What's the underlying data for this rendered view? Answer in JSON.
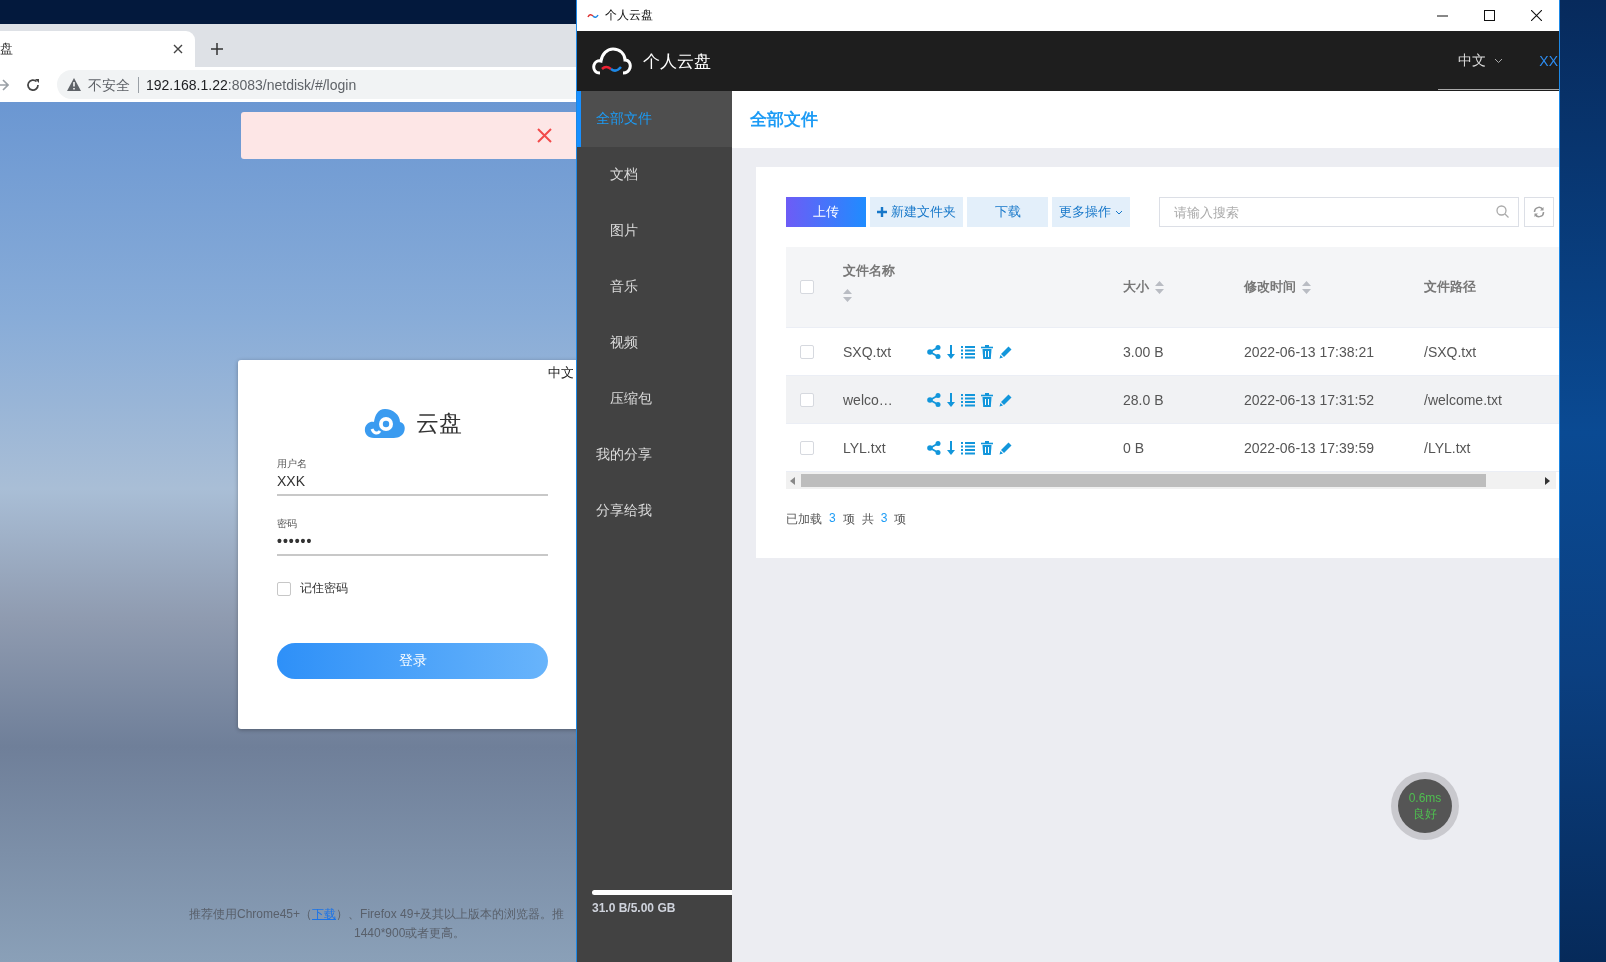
{
  "browser": {
    "tab": {
      "title": "盘",
      "selected": true
    },
    "address": {
      "security": "不安全",
      "host": "192.168.1.22",
      "path": ":8083/netdisk/#/login"
    },
    "alert": {
      "kind": "error"
    },
    "login": {
      "language": "中文",
      "brand": "云盘",
      "fields": [
        {
          "label": "用户名",
          "value": "XXK",
          "kind": "text"
        },
        {
          "label": "密码",
          "value": "••••••",
          "kind": "password"
        }
      ],
      "remember": {
        "label": "记住密码",
        "checked": false
      },
      "submit": "登录",
      "note": {
        "before": "推荐使用Chrome45+（",
        "link": "下载",
        "after": "）、Firefox 49+及其以上版本的浏览器。推",
        "line2": "1440*900或者更高。"
      }
    }
  },
  "app": {
    "window": {
      "title": "个人云盘"
    },
    "brand": "个人云盘",
    "language": "中文",
    "user": "XX",
    "sidebar": {
      "items": [
        {
          "label": "全部文件",
          "selected": true,
          "children": [
            {
              "label": "文档",
              "selected": false
            },
            {
              "label": "图片",
              "selected": false
            },
            {
              "label": "音乐",
              "selected": false
            },
            {
              "label": "视频",
              "selected": false
            },
            {
              "label": "压缩包",
              "selected": false
            }
          ]
        },
        {
          "label": "我的分享",
          "selected": false
        },
        {
          "label": "分享给我",
          "selected": false
        }
      ]
    },
    "storage": {
      "level": 1,
      "reading": "31.0 B/5.00 GB"
    },
    "page_title": "全部文件",
    "toolbar": {
      "buttons": [
        {
          "label": "上传",
          "kind": "primary"
        },
        {
          "label": "新建文件夹",
          "kind": "add"
        },
        {
          "label": "下载",
          "kind": "plain"
        },
        {
          "label": "更多操作",
          "kind": "menu"
        }
      ],
      "search": {
        "placeholder": "请输入搜索"
      }
    },
    "table": {
      "all_checked": false,
      "columns": [
        {
          "label": "文件名称",
          "sortable": true
        },
        {
          "label": "大小",
          "sortable": true
        },
        {
          "label": "修改时间",
          "sortable": true
        },
        {
          "label": "文件路径",
          "sortable": false
        }
      ],
      "rows": [
        {
          "name": "SXQ.txt",
          "size": "3.00 B",
          "modified": "2022-06-13 17:38:21",
          "path": "/SXQ.txt",
          "checked": false,
          "hovered": false
        },
        {
          "name": "welco…",
          "size": "28.0 B",
          "modified": "2022-06-13 17:31:52",
          "path": "/welcome.txt",
          "checked": false,
          "hovered": true
        },
        {
          "name": "LYL.txt",
          "size": "0 B",
          "modified": "2022-06-13 17:39:59",
          "path": "/LYL.txt",
          "checked": false,
          "hovered": false
        }
      ]
    },
    "summary": {
      "loaded_label": "已加载",
      "loaded": "3",
      "loaded_unit": "项",
      "total_label": "共",
      "total": "3",
      "total_unit": "项"
    },
    "latency": {
      "value": "0.6ms",
      "quality": "良好"
    }
  }
}
